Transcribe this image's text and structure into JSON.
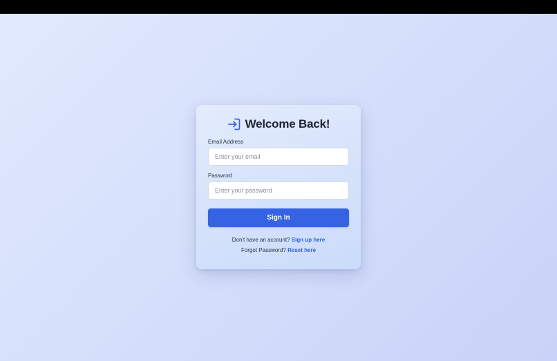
{
  "login": {
    "title": "Welcome Back!",
    "icon": "login-arrow-icon",
    "email": {
      "label": "Email Address",
      "placeholder": "Enter your email",
      "value": ""
    },
    "password": {
      "label": "Password",
      "placeholder": "Enter your password",
      "value": ""
    },
    "submit_label": "Sign In",
    "signup_prompt": "Don't have an account?",
    "signup_link": "Sign up here",
    "forgot_prompt": "Forgot Password?",
    "forgot_link": "Reset here"
  },
  "colors": {
    "accent": "#3563e3",
    "link": "#2f5fd8",
    "heading": "#1b2333"
  }
}
